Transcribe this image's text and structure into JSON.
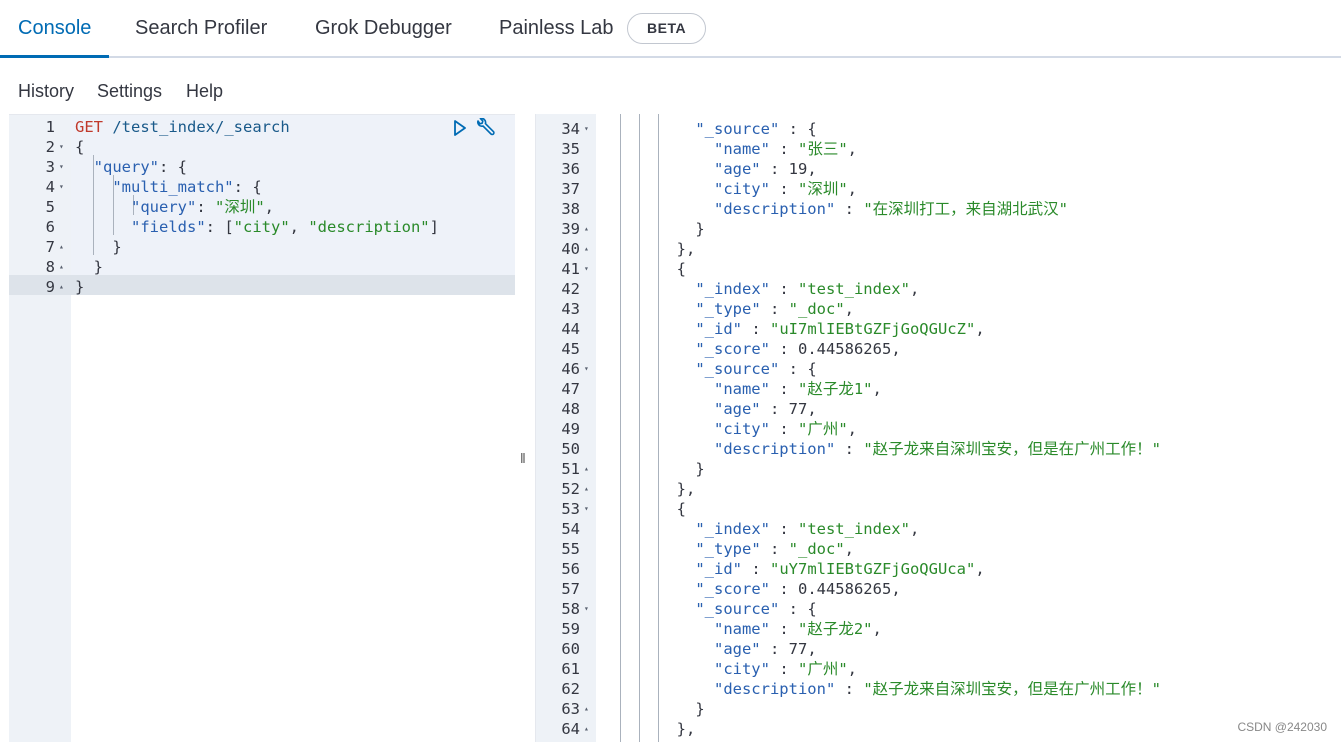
{
  "tabs": [
    {
      "label": "Console",
      "active": true
    },
    {
      "label": "Search Profiler"
    },
    {
      "label": "Grok Debugger"
    },
    {
      "label": "Painless Lab"
    }
  ],
  "beta_badge": "BETA",
  "menu": {
    "history": "History",
    "settings": "Settings",
    "help": "Help"
  },
  "request": {
    "lines": [
      {
        "n": "1",
        "fold": "",
        "text": "GET /test_index/_search"
      },
      {
        "n": "2",
        "fold": "▾",
        "text": "{"
      },
      {
        "n": "3",
        "fold": "▾",
        "text": "  \"query\": {"
      },
      {
        "n": "4",
        "fold": "▾",
        "text": "    \"multi_match\": {"
      },
      {
        "n": "5",
        "fold": "",
        "text": "      \"query\": \"深圳\","
      },
      {
        "n": "6",
        "fold": "",
        "text": "      \"fields\": [\"city\", \"description\"]"
      },
      {
        "n": "7",
        "fold": "▴",
        "text": "    }"
      },
      {
        "n": "8",
        "fold": "▴",
        "text": "  }"
      },
      {
        "n": "9",
        "fold": "▴",
        "text": "}"
      }
    ]
  },
  "response": {
    "lines": [
      {
        "n": "34",
        "fold": "▾",
        "text": "          \"_source\" : {"
      },
      {
        "n": "35",
        "fold": "",
        "text": "            \"name\" : \"张三\","
      },
      {
        "n": "36",
        "fold": "",
        "text": "            \"age\" : 19,"
      },
      {
        "n": "37",
        "fold": "",
        "text": "            \"city\" : \"深圳\","
      },
      {
        "n": "38",
        "fold": "",
        "text": "            \"description\" : \"在深圳打工，来自湖北武汉\""
      },
      {
        "n": "39",
        "fold": "▴",
        "text": "          }"
      },
      {
        "n": "40",
        "fold": "▴",
        "text": "        },"
      },
      {
        "n": "41",
        "fold": "▾",
        "text": "        {"
      },
      {
        "n": "42",
        "fold": "",
        "text": "          \"_index\" : \"test_index\","
      },
      {
        "n": "43",
        "fold": "",
        "text": "          \"_type\" : \"_doc\","
      },
      {
        "n": "44",
        "fold": "",
        "text": "          \"_id\" : \"uI7mlIEBtGZFjGoQGUcZ\","
      },
      {
        "n": "45",
        "fold": "",
        "text": "          \"_score\" : 0.44586265,"
      },
      {
        "n": "46",
        "fold": "▾",
        "text": "          \"_source\" : {"
      },
      {
        "n": "47",
        "fold": "",
        "text": "            \"name\" : \"赵子龙1\","
      },
      {
        "n": "48",
        "fold": "",
        "text": "            \"age\" : 77,"
      },
      {
        "n": "49",
        "fold": "",
        "text": "            \"city\" : \"广州\","
      },
      {
        "n": "50",
        "fold": "",
        "text": "            \"description\" : \"赵子龙来自深圳宝安，但是在广州工作！\""
      },
      {
        "n": "51",
        "fold": "▴",
        "text": "          }"
      },
      {
        "n": "52",
        "fold": "▴",
        "text": "        },"
      },
      {
        "n": "53",
        "fold": "▾",
        "text": "        {"
      },
      {
        "n": "54",
        "fold": "",
        "text": "          \"_index\" : \"test_index\","
      },
      {
        "n": "55",
        "fold": "",
        "text": "          \"_type\" : \"_doc\","
      },
      {
        "n": "56",
        "fold": "",
        "text": "          \"_id\" : \"uY7mlIEBtGZFjGoQGUca\","
      },
      {
        "n": "57",
        "fold": "",
        "text": "          \"_score\" : 0.44586265,"
      },
      {
        "n": "58",
        "fold": "▾",
        "text": "          \"_source\" : {"
      },
      {
        "n": "59",
        "fold": "",
        "text": "            \"name\" : \"赵子龙2\","
      },
      {
        "n": "60",
        "fold": "",
        "text": "            \"age\" : 77,"
      },
      {
        "n": "61",
        "fold": "",
        "text": "            \"city\" : \"广州\","
      },
      {
        "n": "62",
        "fold": "",
        "text": "            \"description\" : \"赵子龙来自深圳宝安，但是在广州工作！\""
      },
      {
        "n": "63",
        "fold": "▴",
        "text": "          }"
      },
      {
        "n": "64",
        "fold": "▴",
        "text": "        },"
      }
    ]
  },
  "watermark": "CSDN @242030",
  "colors": {
    "accent": "#006bb4",
    "method": "#c0392b",
    "key": "#2a60b0",
    "string": "#2a8a2a"
  }
}
